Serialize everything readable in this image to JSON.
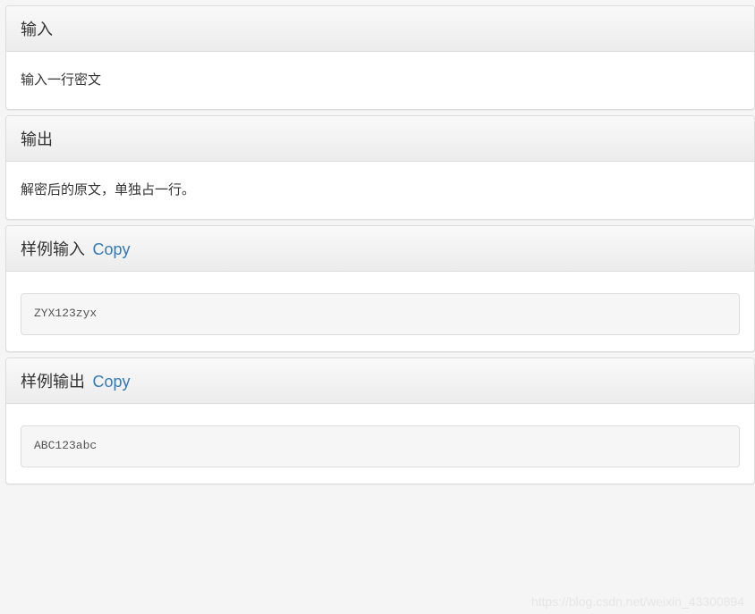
{
  "sections": {
    "input": {
      "title": "输入",
      "body": "输入一行密文"
    },
    "output": {
      "title": "输出",
      "body": "解密后的原文，单独占一行。"
    },
    "sampleInput": {
      "title": "样例输入",
      "copyLabel": "Copy",
      "code": "ZYX123zyx"
    },
    "sampleOutput": {
      "title": "样例输出",
      "copyLabel": "Copy",
      "code": "ABC123abc"
    }
  },
  "watermark": "https://blog.csdn.net/weixin_43300894"
}
